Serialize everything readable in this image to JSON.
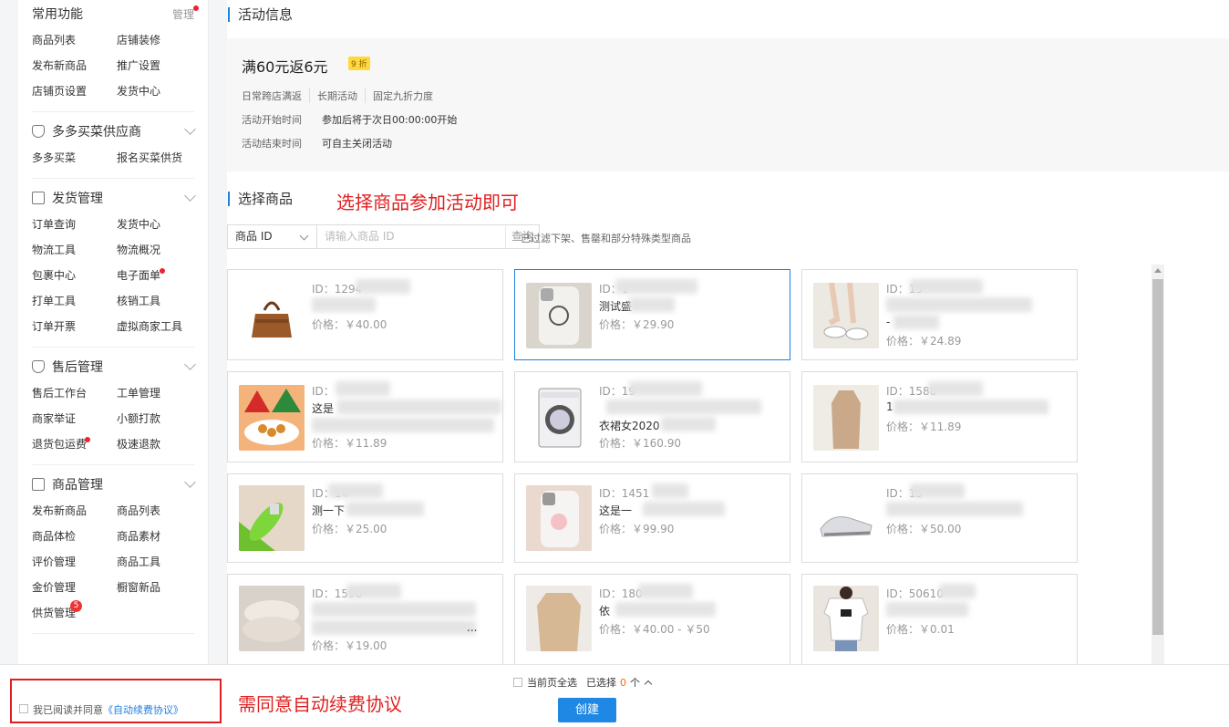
{
  "sidebar": {
    "common": {
      "title": "常用功能",
      "manage": "管理",
      "items": [
        "商品列表",
        "店铺装修",
        "发布新商品",
        "推广设置",
        "店铺页设置",
        "发货中心"
      ]
    },
    "supplier": {
      "title": "多多买菜供应商",
      "items": [
        "多多买菜",
        "报名买菜供货"
      ]
    },
    "shipping": {
      "title": "发货管理",
      "items": [
        "订单查询",
        "发货中心",
        "物流工具",
        "物流概况",
        "包裹中心",
        "电子面单",
        "打单工具",
        "核销工具",
        "订单开票",
        "虚拟商家工具"
      ]
    },
    "aftersale": {
      "title": "售后管理",
      "items": [
        "售后工作台",
        "工单管理",
        "商家举证",
        "小额打款",
        "退货包运费",
        "极速退款"
      ]
    },
    "goods": {
      "title": "商品管理",
      "items": [
        "发布新商品",
        "商品列表",
        "商品体检",
        "商品素材",
        "评价管理",
        "商品工具",
        "金价管理",
        "橱窗新品",
        "供货管理"
      ],
      "badge": "5"
    }
  },
  "activity": {
    "section_title": "活动信息",
    "name": "满60元返6元",
    "badge": "9 折",
    "tags": [
      "日常跨店满返",
      "长期活动",
      "固定九折力度"
    ],
    "start_label": "活动开始时间",
    "start_value": "参加后将于次日00:00:00开始",
    "end_label": "活动结束时间",
    "end_value": "可自主关闭活动"
  },
  "select": {
    "section_title": "选择商品",
    "note": "选择商品参加活动即可",
    "search_type": "商品 ID",
    "search_placeholder": "请输入商品 ID",
    "search_button": "查询",
    "filter_hint": "已过滤下架、售罄和部分特殊类型商品"
  },
  "products": [
    {
      "id": "ID：1294",
      "name": "",
      "price": "价格：￥40.00"
    },
    {
      "id": "ID：1",
      "name": "测试盛",
      "price": "价格：￥29.90"
    },
    {
      "id": "ID：15",
      "name": "-",
      "price": "价格：￥24.89"
    },
    {
      "id": "ID：",
      "name": "这是",
      "price": "价格：￥11.89"
    },
    {
      "id": "ID：19",
      "name": "衣裙女2020",
      "price": "价格：￥160.90"
    },
    {
      "id": "ID：1588",
      "name": "1",
      "price": "价格：￥11.89"
    },
    {
      "id": "ID：14",
      "name": "测一下",
      "price": "价格：￥25.00"
    },
    {
      "id": "ID：1451",
      "name": "这是一",
      "price": "价格：￥99.90"
    },
    {
      "id": "ID：13",
      "name": "",
      "price": "价格：￥50.00"
    },
    {
      "id": "ID：1596",
      "name": "...",
      "price": "价格：￥19.00"
    },
    {
      "id": "ID：180",
      "name": "依",
      "price": "价格：￥40.00 - ￥50"
    },
    {
      "id": "ID：50610",
      "name": "",
      "price": "价格：￥0.01"
    }
  ],
  "footer": {
    "agree_text": "我已阅读并同意",
    "agree_link": "《自动续费协议》",
    "note": "需同意自动续费协议",
    "select_all": "当前页全选",
    "selected_prefix": "已选择",
    "selected_count": "0",
    "selected_suffix": "个",
    "create_button": "创建"
  }
}
